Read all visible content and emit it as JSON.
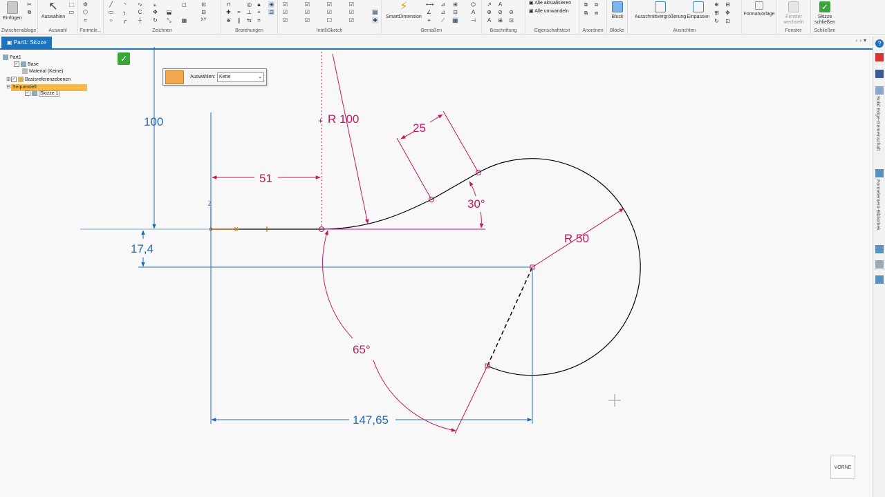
{
  "ribbon": {
    "einfuegen": "Einfügen",
    "zwischenablage": "Zwischenablage",
    "auswaehlen_btn": "Auswählen",
    "auswahl": "Auswahl",
    "formele": "Formele...",
    "zeichnen": "Zeichnen",
    "beziehungen": "Beziehungen",
    "intellisketch": "IntelliSketch",
    "smartdimension": "SmartDimension",
    "bemassen": "Bemaßen",
    "beschriftung": "Beschriftung",
    "alle_aktualisieren": "Alle aktualisieren",
    "alle_umwandeln": "Alle umwandeln",
    "eigenschaftstext": "Eigenschaftstext",
    "anordnen": "Anordnen",
    "block": "Block",
    "bloecke": "Blöcke",
    "ausschnitt": "Ausschnittvergrößerung",
    "einpassen": "Einpassen",
    "ausrichten": "Ausrichten",
    "formatvorlage": "Formatvorlage",
    "fenster_wechseln": "Fenster wechseln",
    "fenster": "Fenster",
    "skizze_schliessen": "Skizze schließen",
    "schliessen": "Schließen"
  },
  "tabs": {
    "document_tab": "Part1: Skizze"
  },
  "tree": {
    "part": "Part1",
    "base": "Base",
    "material": "Material (Keine)",
    "basisref": "Basisreferenzebenen",
    "sequentiell": "Sequentiell",
    "skizze": "Skizze 1"
  },
  "cmdbar": {
    "label": "Auswählen:",
    "value": "Kette"
  },
  "right_bar": {
    "community": "Solid Edge-Gemeinschaft",
    "library": "Formelement-Bibliothek"
  },
  "dims": {
    "d100": "100",
    "d17": "17,4",
    "d51": "51",
    "r100": "R 100",
    "d25": "25",
    "d30": "30°",
    "r50": "R 50",
    "d65": "65°",
    "d147": "147,65",
    "axis_z": "Z",
    "axis_x": "X"
  },
  "view_cube": {
    "label": "VORNE"
  },
  "colors": {
    "accent": "#1e73be",
    "dim_blue": "#1f6db5",
    "dim_red": "#c2185b",
    "geometry": "#000000"
  }
}
